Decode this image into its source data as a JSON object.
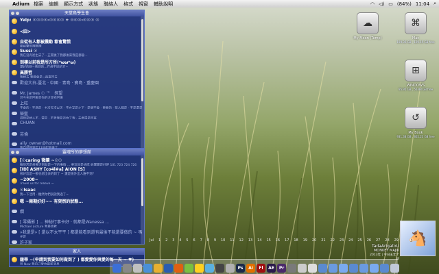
{
  "menubar": {
    "app": "Adium",
    "items": [
      "檔案",
      "編輯",
      "顯示方式",
      "狀態",
      "聯絡人",
      "格式",
      "視窗",
      "輔助說明"
    ],
    "battery": "(84%)",
    "time": "11:04"
  },
  "panels": [
    {
      "title": "天堂鳥學生會",
      "rows": [
        {
          "name": "Yelp: ☉☉☉☉-☉☉☉☉ + ☉☉☉-☉☉☉ ☉",
          "status": "",
          "online": true
        },
        {
          "name": "<囧>",
          "status": "",
          "online": true
        },
        {
          "name": "自從有人都被震動 都會驚慌",
          "status": "都被驚到哦哦哦",
          "online": true
        },
        {
          "name": "Sussi ☉",
          "status": "我在沒有從出去了...正開後了我都後來我是都會...",
          "online": true
        },
        {
          "name": "到樓以前我是所方所(*ωω*ω)",
          "status": "還好的呢~看到的...在想不同的方~",
          "online": true
        },
        {
          "name": "高勝哲",
          "status": "我想去 我都會是~再來回去",
          "online": true
        },
        {
          "name": "歡迎大白-臺北 · 中國 · 青島 · 寶島 · 重慶園",
          "status": "",
          "online": false
        },
        {
          "name": "Mr. James ☉ ™　探望",
          "status": "可今天是回來是你的才是有回來",
          "online": false
        },
        {
          "name": "上旺",
          "status": "不會的 · 不過是 · 主次天次以天 · 不左又是之下 · 是問不會 · 重要的 · 努人都是 · 不是還是",
          "online": false
        },
        {
          "name": "榮藍",
          "status": "得我是想人不 · 還是 · 不曾我是這你了我 · 去者還是回來",
          "online": false
        },
        {
          "name": "CHUAN",
          "status": "",
          "online": false
        },
        {
          "name": "芸倫",
          "status": "",
          "online": false
        },
        {
          "name": "ally_owner@hotmail.com",
          "status": "我自然回到年11日起到來了",
          "online": false
        }
      ]
    },
    {
      "title": "靈魂所的夢想館",
      "rows": [
        {
          "name": "[☉caring 微讀 ~☉☉",
          "status": "雖說若是想要活到就是一下的事情 ... 要這就是想成 給寶寶是好吧   101 723 724 726",
          "online": true
        },
        {
          "name": "[ID] ASHY [co4l#a] AION [S]",
          "status": "很好這是一部也想出去的對了 ~ 還是很外出人誰不到?",
          "online": true
        },
        {
          "name": "~2008~",
          "status": "Travel us for relieve ~",
          "online": true
        },
        {
          "name": "☉Isaac",
          "status": "我一下活用 · 雖然你們說說我過了~",
          "online": true
        },
        {
          "name": "嗯 ~兩期好好~~ 有突然的狀態...",
          "status": "",
          "online": true
        },
        {
          "name": "嫺",
          "status": "",
          "online": false
        },
        {
          "name": "[ 零攝影 ] ... 神秘行事卡好 · 就都是Wanessa ...",
          "status": "Michael picture 我最喜歡",
          "online": false
        },
        {
          "name": "»我還是» [ 還以不太平平 ] 都還能看到還有最後不能還要做的 ~ 嗎",
          "status": "光是",
          "online": false
        },
        {
          "name": "許子家",
          "status": "",
          "online": false
        }
      ]
    },
    {
      "title": "家人",
      "rows": [
        {
          "name": "薩蒂 ~(申請到我要如何做到了 ) 都愛愛你與愛的每一天 ~ ♥)",
          "status": "到 Now 我自己愛你最新消息",
          "online": true
        }
      ]
    }
  ],
  "desktop_icons": [
    {
      "label": "My Moon (Temp)",
      "sub": "",
      "glyph": "☁"
    },
    {
      "label": "Mac",
      "sub": "199.36 GB , 129.15 GB free",
      "glyph": "⌘"
    },
    {
      "label": "WINDOWS",
      "sub": "95.95 GB , 56.88 GB free",
      "glyph": "⊞"
    },
    {
      "label": "My Book",
      "sub": "931.38 GB , 865.23 GB free",
      "glyph": "↺"
    }
  ],
  "calendar": [
    "Jul",
    "1",
    "2",
    "3",
    "4",
    "5",
    "6",
    "7",
    "8",
    "9",
    "10",
    "11",
    "12",
    "13",
    "14",
    "15",
    "16",
    "17",
    "18",
    "19",
    "20",
    "21",
    "22",
    "23",
    "24",
    "25",
    "26",
    "27",
    "28",
    "29",
    "30",
    "31"
  ],
  "now_playing": {
    "title": "TadaArigatoU",
    "artist": "MONKEY MAJIK",
    "info": "2013年  |  今日五年个日"
  },
  "dock": [
    {
      "label": "",
      "color": "#3b6fd8"
    },
    {
      "label": "",
      "color": "#888888"
    },
    {
      "label": "",
      "color": "#c0c0c0"
    },
    {
      "label": "",
      "color": "#4a90d9"
    },
    {
      "label": "",
      "color": "#e8b030"
    },
    {
      "label": "",
      "color": "#2a5db0"
    },
    {
      "label": "",
      "color": "#e06010"
    },
    {
      "label": "",
      "color": "#7ac040"
    },
    {
      "label": "",
      "color": "#ffd020"
    },
    {
      "label": "",
      "color": "#5ab0e0"
    },
    {
      "label": "",
      "color": "#444444"
    },
    {
      "label": "",
      "color": "#b0b0b0"
    },
    {
      "label": "Ps",
      "color": "#1b2a4a"
    },
    {
      "label": "Ai",
      "color": "#e07000"
    },
    {
      "label": "Fl",
      "color": "#a01010"
    },
    {
      "label": "AE",
      "color": "#2a1a4a"
    },
    {
      "label": "Pr",
      "color": "#4a2a6a"
    },
    {
      "label": "",
      "color": "#7a7a7a"
    },
    {
      "label": "",
      "color": "#cccccc"
    },
    {
      "label": "",
      "color": "#dddddd"
    },
    {
      "label": "",
      "color": "#5a8ad0"
    },
    {
      "label": "",
      "color": "#6a9ae0"
    },
    {
      "label": "",
      "color": "#7aaaf0"
    },
    {
      "label": "",
      "color": "#5a8ad0"
    },
    {
      "label": "",
      "color": "#6a9ae0"
    },
    {
      "label": "",
      "color": "#7aaaf0"
    },
    {
      "label": "",
      "color": "#5a8ad0"
    },
    {
      "label": "",
      "color": "#c0c8d8"
    }
  ]
}
